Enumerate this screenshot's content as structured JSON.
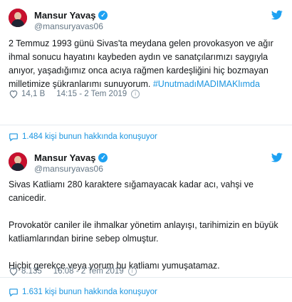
{
  "tweets": [
    {
      "author_name": "Mansur Yavaş",
      "handle": "@mansuryavas06",
      "text_main": "2 Temmuz 1993 günü Sivas'ta meydana gelen provokasyon ve ağır ihmal sonucu hayatını kaybeden aydın ve sanatçılarımızı saygıyla anıyor, yaşadığımız onca acıya rağmen kardeşliğini hiç bozmayan milletimize şükranlarımı sunuyorum. ",
      "hashtag": "#UnutmadıMADIMAKlımda",
      "likes": "14,1 B",
      "time": "14:15 - 2 Tem 2019",
      "conversation": "1.484 kişi bunun hakkında konuşuyor"
    },
    {
      "author_name": "Mansur Yavaş",
      "handle": "@mansuryavas06",
      "paragraphs": [
        "Sivas Katliamı 280 karaktere sığamayacak kadar acı, vahşi ve canicedir.",
        "Provokatör caniler ile ihmalkar yönetim anlayışı, tarihimizin en büyük katliamlarından birine sebep olmuştur.",
        "Hiçbir gerekçe veya yorum bu katliamı yumuşatamaz."
      ],
      "likes": "8.135",
      "time": "16:08 - 2 Tem 2019",
      "conversation": "1.631 kişi bunun hakkında konuşuyor"
    }
  ],
  "colors": {
    "link": "#1b95e0",
    "verified": "#1da1f2",
    "muted": "#657786"
  },
  "icons": {
    "verified": "verified-badge-icon",
    "brand": "twitter-bird-icon",
    "like": "heart-icon",
    "info": "info-icon",
    "conversation": "speech-bubble-icon"
  }
}
